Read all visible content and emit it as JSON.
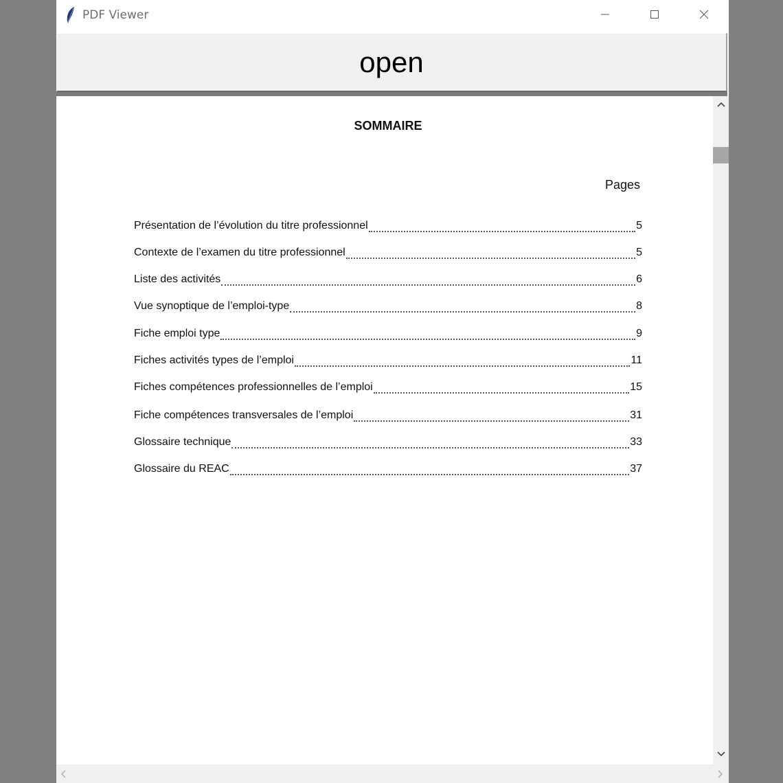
{
  "window": {
    "title": "PDF Viewer",
    "icon": "feather-icon",
    "controls": [
      "minimize-icon",
      "maximize-icon",
      "close-icon"
    ]
  },
  "toolbar": {
    "open_label": "open"
  },
  "document": {
    "title": "SOMMAIRE",
    "pages_header": "Pages",
    "toc": [
      {
        "label": "Présentation de l’évolution du titre professionnel",
        "page": "5"
      },
      {
        "label": "Contexte de l’examen du titre professionnel",
        "page": "5"
      },
      {
        "label": "Liste des activités",
        "page": "6"
      },
      {
        "label": "Vue synoptique de l’emploi-type",
        "page": "8"
      },
      {
        "label": "Fiche emploi type",
        "page": "9"
      },
      {
        "label": "Fiches activités types de l’emploi",
        "page": "11"
      },
      {
        "label": "Fiches compétences professionnelles de l’emploi",
        "page": "15"
      },
      {
        "label": "Fiche compétences transversales de l’emploi",
        "page": "31"
      },
      {
        "label": "Glossaire technique",
        "page": "33"
      },
      {
        "label": "Glossaire du REAC",
        "page": "37"
      }
    ]
  },
  "colors": {
    "desktop": "#808080",
    "button_face": "#f0f0f0",
    "scroll_thumb": "#a6a6a6",
    "title_text": "#6e6e6e"
  }
}
